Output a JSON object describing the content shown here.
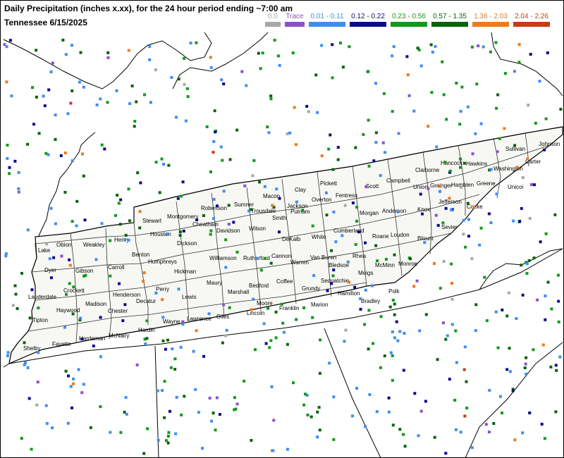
{
  "header": {
    "title_line1": "Daily Precipitation (inches  x.xx),  for the 24 hour period ending ~7:00 am",
    "title_line2": "Tennessee 6/15/2025"
  },
  "legend": [
    {
      "label": "0.0",
      "color": "#a8a8a8"
    },
    {
      "label": "Trace",
      "color": "#8a52c8"
    },
    {
      "label": "0.01 - 0.11",
      "color": "#3e8ef0"
    },
    {
      "label": "0.12 - 0.22",
      "color": "#0a0a8c"
    },
    {
      "label": "0.23 - 0.56",
      "color": "#119a1a"
    },
    {
      "label": "0.57 - 1.35",
      "color": "#086408"
    },
    {
      "label": "1.36 - 2.03",
      "color": "#f07a1a"
    },
    {
      "label": "2.04 - 2.26",
      "color": "#c83c14"
    }
  ],
  "counties": [
    "Stewart",
    "Montgomery",
    "Robertson",
    "Sumner",
    "Macon",
    "Clay",
    "Pickett",
    "Scott",
    "Campbell",
    "Claiborne",
    "Hancock",
    "Hawkins",
    "Sullivan",
    "Johnson",
    "Fentress",
    "Overton",
    "Jackson",
    "Trousdale",
    "Smith",
    "Cheatham",
    "Davidson",
    "Wilson",
    "Houston",
    "Dickson",
    "Henry",
    "Weakley",
    "Obion",
    "Lake",
    "Dyer",
    "Gibson",
    "Carroll",
    "Benton",
    "Humphreys",
    "Williamson",
    "Rutherford",
    "Cannon",
    "DeKalb",
    "Putnam",
    "White",
    "Cumberland",
    "Morgan",
    "Anderson",
    "Union",
    "Grainger",
    "Hamblen",
    "Greene",
    "Washington",
    "Carter",
    "Unicoi",
    "Jefferson",
    "Cocke",
    "Sevier",
    "Knox",
    "Loudon",
    "Blount",
    "Roane",
    "Monroe",
    "McMinn",
    "Meigs",
    "Rhea",
    "Bledsoe",
    "Van Buren",
    "Warren",
    "Coffee",
    "Bedford",
    "Marshall",
    "Maury",
    "Hickman",
    "Perry",
    "Decatur",
    "Henderson",
    "Madison",
    "Crockett",
    "Lauderdale",
    "Haywood",
    "Tipton",
    "Shelby",
    "Fayette",
    "Hardeman",
    "Chester",
    "McNairy",
    "Hardin",
    "Wayne",
    "Lawrence",
    "Giles",
    "Lincoln",
    "Moore",
    "Franklin",
    "Grundy",
    "Marion",
    "Sequatchie",
    "Hamilton",
    "Bradley",
    "Polk",
    "Lewis",
    "Lake"
  ]
}
